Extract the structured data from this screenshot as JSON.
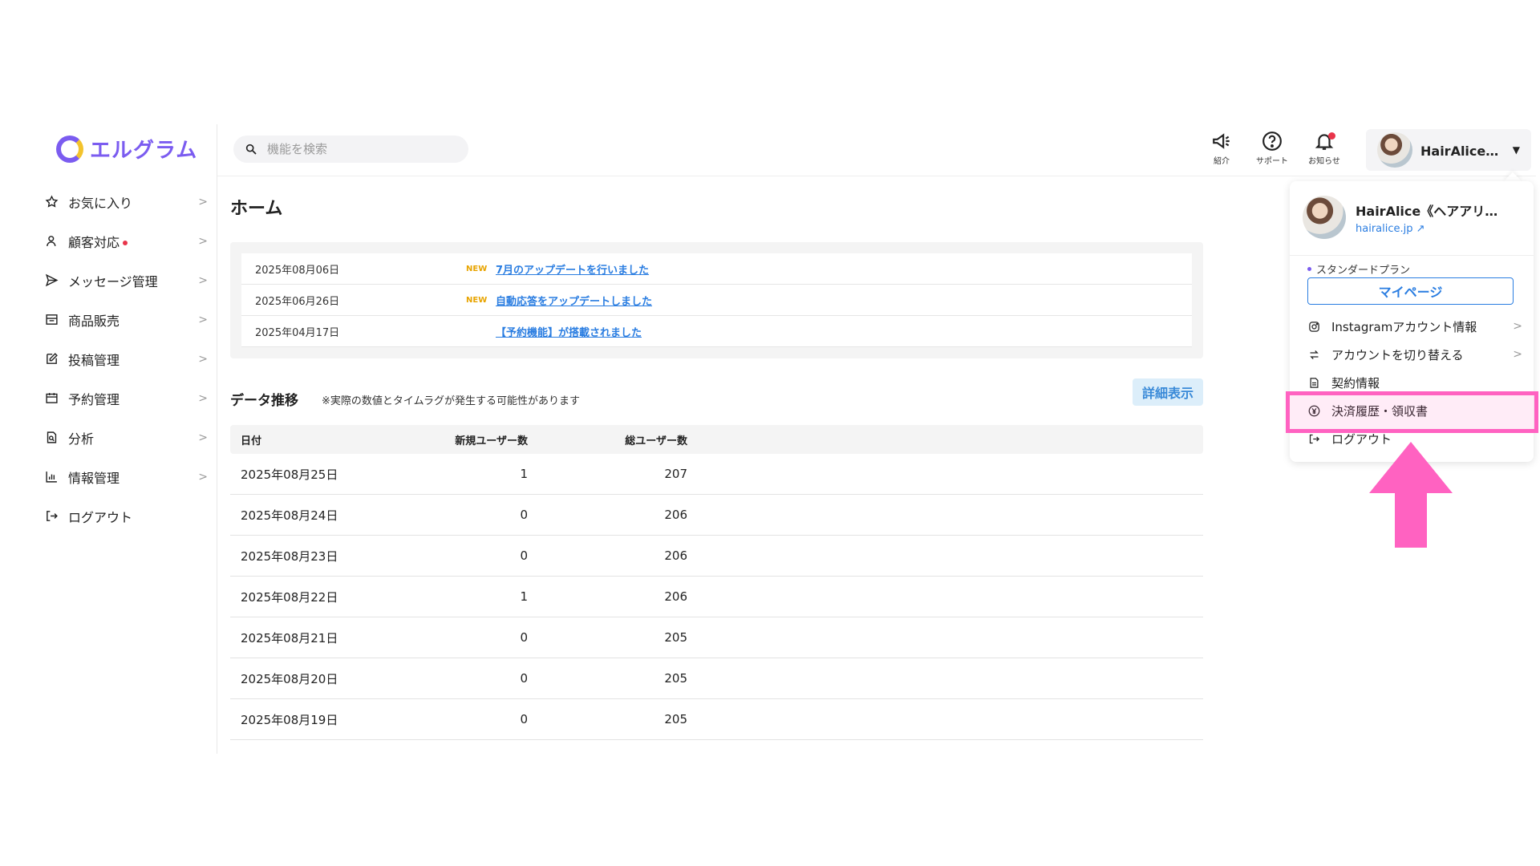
{
  "app": {
    "logo_text": "エルグラム"
  },
  "search": {
    "placeholder": "機能を検索"
  },
  "sidebar": {
    "items": [
      {
        "label": "お気に入り",
        "icon": "star-icon"
      },
      {
        "label": "顧客対応",
        "icon": "person-icon",
        "has_dot": true
      },
      {
        "label": "メッセージ管理",
        "icon": "send-icon"
      },
      {
        "label": "商品販売",
        "icon": "store-icon"
      },
      {
        "label": "投稿管理",
        "icon": "edit-icon"
      },
      {
        "label": "予約管理",
        "icon": "calendar-icon"
      },
      {
        "label": "分析",
        "icon": "analysis-icon"
      },
      {
        "label": "情報管理",
        "icon": "bar-chart-icon"
      },
      {
        "label": "ログアウト",
        "icon": "logout-icon"
      }
    ]
  },
  "header": {
    "intro_label": "紹介",
    "support_label": "サポート",
    "notice_label": "お知らせ",
    "account_name": "HairAlice《ヘアアリス…"
  },
  "main": {
    "title": "ホーム",
    "news": [
      {
        "date": "2025年08月06日",
        "new": "NEW",
        "text": "7月のアップデートを行いました"
      },
      {
        "date": "2025年06月26日",
        "new": "NEW",
        "text": "自動応答をアップデートしました"
      },
      {
        "date": "2025年04月17日",
        "new": "",
        "text": "【予約機能】が搭載されました"
      }
    ],
    "data_title": "データ推移",
    "data_note": "※実際の数値とタイムラグが発生する可能性があります",
    "detail_button": "詳細表示",
    "table": {
      "headers": [
        "日付",
        "新規ユーザー数",
        "総ユーザー数"
      ],
      "rows": [
        [
          "2025年08月25日",
          "1",
          "207"
        ],
        [
          "2025年08月24日",
          "0",
          "206"
        ],
        [
          "2025年08月23日",
          "0",
          "206"
        ],
        [
          "2025年08月22日",
          "1",
          "206"
        ],
        [
          "2025年08月21日",
          "0",
          "205"
        ],
        [
          "2025年08月20日",
          "0",
          "205"
        ],
        [
          "2025年08月19日",
          "0",
          "205"
        ]
      ]
    }
  },
  "dropdown": {
    "name": "HairAlice《ヘアアリス…",
    "site": "hairalice.jp",
    "plan": "スタンダードプラン",
    "mypage": "マイページ",
    "items": [
      {
        "label": "Instagramアカウント情報",
        "icon": "instagram-icon",
        "chevron": ">"
      },
      {
        "label": "アカウントを切り替える",
        "icon": "switch-icon",
        "chevron": ">"
      },
      {
        "label": "契約情報",
        "icon": "document-icon",
        "chevron": ""
      },
      {
        "label": "決済履歴・領収書",
        "icon": "yen-icon",
        "chevron": ""
      },
      {
        "label": "ログアウト",
        "icon": "logout-icon",
        "chevron": ""
      }
    ]
  },
  "colors": {
    "brand": "#7b5cf0",
    "link": "#2a7de1",
    "highlight": "#ff62c1",
    "new_badge": "#e8a400",
    "alert": "#e8344a"
  }
}
